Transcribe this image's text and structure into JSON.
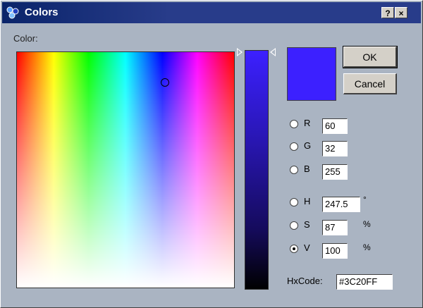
{
  "window": {
    "title": "Colors",
    "help_label": "?",
    "close_label": "×"
  },
  "color_label": "Color:",
  "current_color": "#3C20FF",
  "buttons": {
    "ok": "OK",
    "cancel": "Cancel"
  },
  "rgb": [
    {
      "label": "R",
      "value": "60",
      "checked": false
    },
    {
      "label": "G",
      "value": "32",
      "checked": false
    },
    {
      "label": "B",
      "value": "255",
      "checked": false
    }
  ],
  "hsv": [
    {
      "label": "H",
      "value": "247.5",
      "unit": "°",
      "checked": false
    },
    {
      "label": "S",
      "value": "87",
      "unit": "%",
      "checked": false
    },
    {
      "label": "V",
      "value": "100",
      "unit": "%",
      "checked": true
    }
  ],
  "hex": {
    "label": "HxCode:",
    "value": "#3C20FF"
  }
}
